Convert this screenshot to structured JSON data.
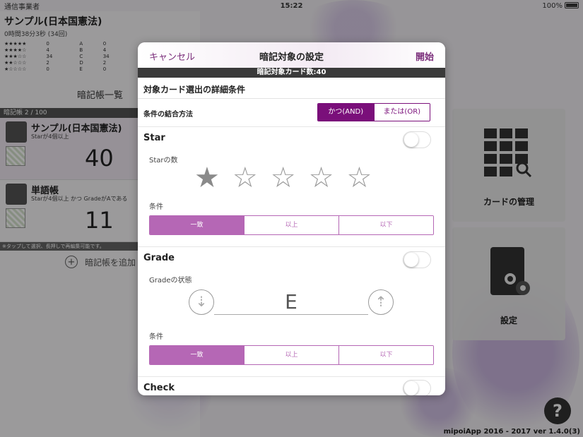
{
  "status": {
    "carrier": "通信事業者",
    "time": "15:22",
    "battery": "100%"
  },
  "deck": {
    "title": "サンプル(日本国憲法)",
    "time": "0時間38分3秒 (34回)",
    "star_counts": [
      "0",
      "4",
      "34",
      "2",
      "0"
    ],
    "grade_letters": [
      "A",
      "B",
      "C",
      "D",
      "E"
    ],
    "grade_counts": [
      "0",
      "4",
      "34",
      "2",
      "0"
    ],
    "star_rows": [
      "★★★★★",
      "★★★★☆",
      "★★★☆☆",
      "★★☆☆☆",
      "★☆☆☆☆"
    ]
  },
  "left": {
    "section_title": "暗記帳一覧",
    "deck_count": "暗記帳 2 / 100",
    "items": [
      {
        "title": "サンプル(日本国憲法)",
        "sub": "Starが4個以上",
        "count": "40"
      },
      {
        "title": "単語帳",
        "sub": "Starが4個以上 かつ GradeがAである",
        "count": "11"
      }
    ],
    "note": "※タップして選択、長押しで再編集可能です。",
    "add_label": "暗記帳を追加"
  },
  "tiles": {
    "manage": "カードの管理",
    "settings": "設定"
  },
  "footer": "mipoiApp 2016 - 2017 ver 1.4.0(3)",
  "help": "?",
  "modal": {
    "cancel": "キャンセル",
    "title": "暗記対象の設定",
    "start": "開始",
    "count_bar": "暗記対象カード数:40",
    "section": "対象カード選出の詳細条件",
    "combine_label": "条件の結合方法",
    "combine_and": "かつ(AND)",
    "combine_or": "または(OR)",
    "star": {
      "name": "Star",
      "count_label": "Starの数",
      "cond_label": "条件",
      "filled": 1
    },
    "grade": {
      "name": "Grade",
      "state_label": "Gradeの状態",
      "value": "E",
      "cond_label": "条件"
    },
    "cond_options": [
      "一致",
      "以上",
      "以下"
    ],
    "check": {
      "name": "Check"
    }
  }
}
